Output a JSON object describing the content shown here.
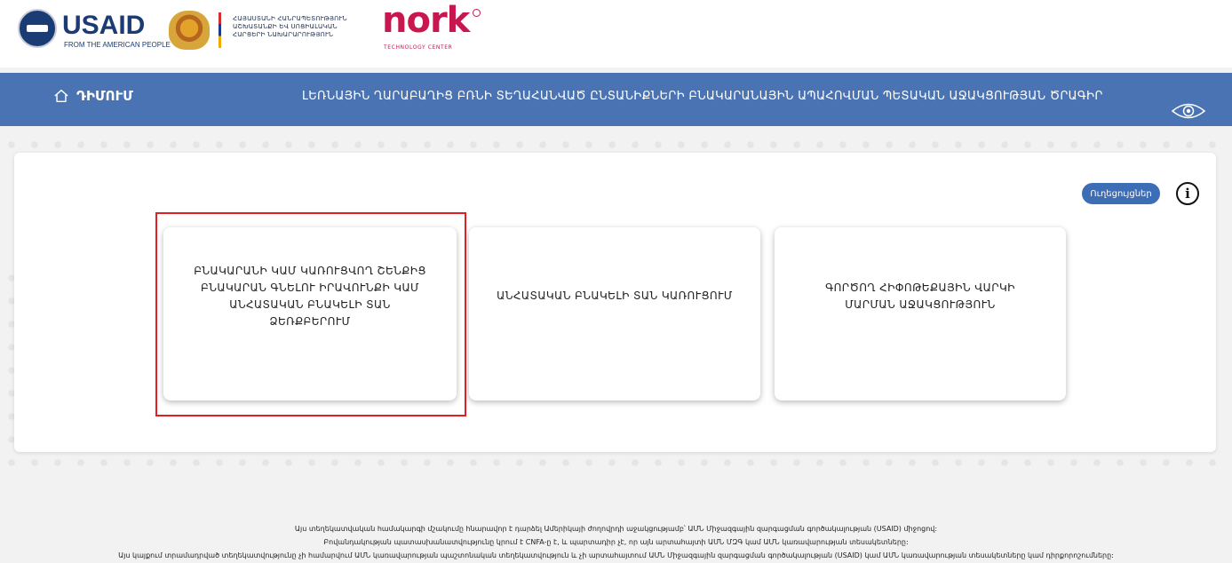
{
  "header": {
    "usaid": {
      "word": "USAID",
      "tagline": "FROM THE AMERICAN PEOPLE"
    },
    "ministry": {
      "line1": "ՀԱՅԱՍՏԱՆԻ ՀԱՆՐԱՊԵՏՈՒԹՅՈՒՆ",
      "line2": "ԱՇԽԱՏԱՆՔԻ ԵՎ ՍՈՑԻԱԼԱԿԱՆ",
      "line3": "ՀԱՐՑԵՐԻ ՆԱԽԱՐԱՐՈՒԹՅՈՒՆ"
    },
    "nork": {
      "word": "nork",
      "tagline": "TECHNOLOGY CENTER"
    }
  },
  "navbar": {
    "home_label": "ԴԻՄՈՒՄ",
    "program_title": "ԼԵՌՆԱՅԻՆ ՂԱՐԱԲԱՂԻՑ ԲՌՆԻ ՏԵՂԱՀԱՆՎԱԾ ԸՆՏԱՆԻՔՆԵՐԻ ԲՆԱԿԱՐԱՆԱՅԻՆ ԱՊԱՀՈՎՄԱՆ ՊԵՏԱԿԱՆ ԱՋԱԿՑՈՒԹՅԱՆ ԾՐԱԳԻՐ"
  },
  "panel": {
    "guides_button": "Ուղեցույցներ",
    "info_glyph": "i",
    "cards": [
      {
        "label": "ԲՆԱԿԱՐԱՆԻ ԿԱՄ ԿԱՌՈՒՑՎՈՂ ՇԵՆՔԻՑ ԲՆԱԿԱՐԱՆ ԳՆԵԼՈՒ ԻՐԱՎՈՒՆՔԻ ԿԱՄ ԱՆՀԱՏԱԿԱՆ ԲՆԱԿԵԼԻ ՏԱՆ ՁԵՌՔԲԵՐՈՒՄ",
        "selected": true
      },
      {
        "label": "ԱՆՀԱՏԱԿԱՆ ԲՆԱԿԵԼԻ ՏԱՆ ԿԱՌՈՒՑՈՒՄ",
        "selected": false
      },
      {
        "label": "ԳՈՐԾՈՂ ՀԻՓՈԹԵՔԱՅԻՆ ՎԱՐԿԻ ՄԱՐՄԱՆ ԱՋԱԿՑՈՒԹՅՈՒՆ",
        "selected": false
      }
    ]
  },
  "footer": {
    "line1": "Այս տեղեկատվական համակարգի մշակումը հնարավոր է դարձել Ամերիկայի ժողովրդի աջակցությամբ՝ ԱՄՆ Միջազգային զարգացման գործակալության (USAID) միջոցով:",
    "line2": "Բովանդակության պատասխանատվությունը կրում է CNFA-ը է, և պարտադիր չէ, որ այն արտահայտի ԱՄՆ ՄԶԳ կամ ԱՄՆ կառավարության տեսակետները:",
    "line3": "Այս կայքում տրամադրված տեղեկատվությունը չի համարվում ԱՄՆ կառավարության պաշտոնական տեղեկատվություն և չի արտահայտում ԱՄՆ Միջազգային զարգացման գործակալության (USAID) կամ ԱՄՆ կառավարության տեսակետները կամ դիրքորոշումները:"
  },
  "colors": {
    "navbar": "#4a73b3",
    "button": "#3d6db5",
    "selection_frame": "#e21e25",
    "brand_nork": "#c8174f",
    "brand_usaid": "#1b3b74"
  }
}
